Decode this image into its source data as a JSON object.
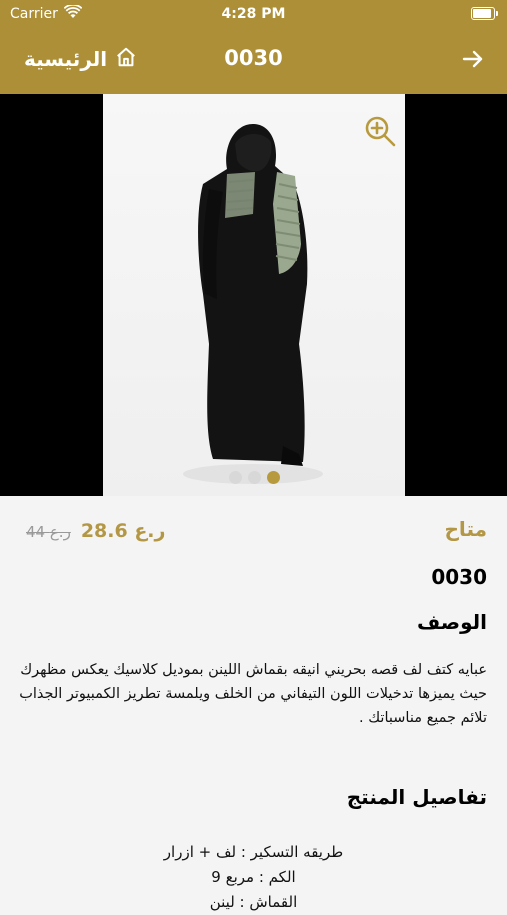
{
  "status_bar": {
    "carrier": "Carrier",
    "time": "4:28 PM",
    "battery_level": 1.0
  },
  "navbar": {
    "home_label": "الرئيسية",
    "title": "0030",
    "icons": [
      "home-icon",
      "arrow-right-icon"
    ]
  },
  "gallery": {
    "image_count": 3,
    "active_index": 2,
    "zoom_icon": "zoom-in-icon"
  },
  "product": {
    "availability": "متاح",
    "price": "28.6 ر.ع",
    "old_price": "44 ر.ع",
    "code": "0030",
    "description_title": "الوصف",
    "description": "عبايه كتف لف قصه بحريني انيقه بقماش اللينن بموديل كلاسيك يعكس مظهرك حيث يميزها تدخيلات اللون التيفاني من الخلف ويلمسة تطريز الكمبيوتر الجذاب تلائم جميع مناسباتك .",
    "details_title": "تفاصيل المنتج",
    "details": [
      "طريقه التسكير : لف + ازرار",
      "الكم : مربع 9",
      "القماش : لينن"
    ]
  },
  "colors": {
    "brand": "#ad8f38",
    "accent": "#b39745"
  }
}
